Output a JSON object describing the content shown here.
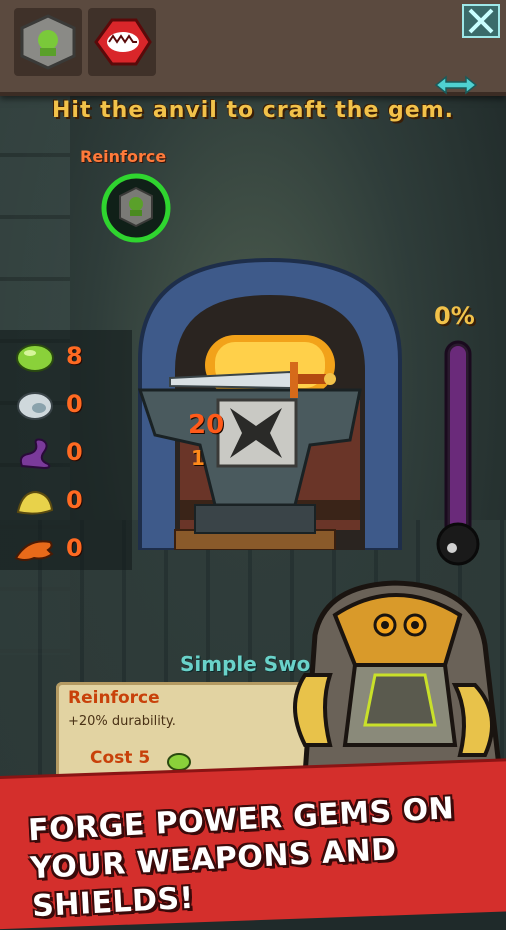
{
  "hint": "Hit the anvil to craft the gem.",
  "gem_type_label": "Reinforce",
  "progress_percent_label": "0%",
  "progress_fraction": 0.0,
  "anvil": {
    "big_number": "20",
    "small_number": "1"
  },
  "resources": [
    {
      "icon": "green-slime-icon",
      "count": "8"
    },
    {
      "icon": "silver-ore-icon",
      "count": "0"
    },
    {
      "icon": "purple-tentacle-icon",
      "count": "0"
    },
    {
      "icon": "yellow-ore-icon",
      "count": "0"
    },
    {
      "icon": "orange-claw-icon",
      "count": "0"
    }
  ],
  "item_name": "Simple Swo",
  "scroll": {
    "title": "Reinforce",
    "description": "+20% durability.",
    "cost_label": "Cost",
    "cost_value": "5"
  },
  "banner": "FORGE POWER GEMS ON YOUR WEAPONS AND SHIELDS!",
  "colors": {
    "accent": "#f2c24a",
    "banner": "#d42f2c",
    "thermo": "#6a2a7a"
  }
}
